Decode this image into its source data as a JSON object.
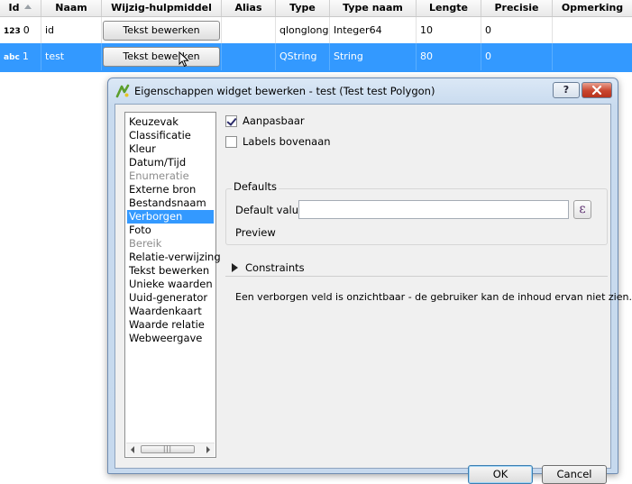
{
  "table": {
    "headers": [
      "Id",
      "Naam",
      "Wijzig-hulpmiddel",
      "Alias",
      "Type",
      "Type naam",
      "Lengte",
      "Precisie",
      "Opmerking"
    ],
    "rows": [
      {
        "type_badge": "123",
        "id": "0",
        "name": "id",
        "widget": "Tekst bewerken",
        "alias": "",
        "type": "qlonglong",
        "type_name": "Integer64",
        "length": "10",
        "precision": "0",
        "comment": ""
      },
      {
        "type_badge": "abc",
        "id": "1",
        "name": "test",
        "widget": "Tekst bewerken",
        "alias": "",
        "type": "QString",
        "type_name": "String",
        "length": "80",
        "precision": "0",
        "comment": ""
      }
    ]
  },
  "dialog": {
    "title": "Eigenschappen widget bewerken - test (Test test Polygon)",
    "help_label": "?",
    "widget_types": [
      {
        "label": "Keuzevak",
        "state": "normal"
      },
      {
        "label": "Classificatie",
        "state": "normal"
      },
      {
        "label": "Kleur",
        "state": "normal"
      },
      {
        "label": "Datum/Tijd",
        "state": "normal"
      },
      {
        "label": "Enumeratie",
        "state": "disabled"
      },
      {
        "label": "Externe bron",
        "state": "normal"
      },
      {
        "label": "Bestandsnaam",
        "state": "normal"
      },
      {
        "label": "Verborgen",
        "state": "selected"
      },
      {
        "label": "Foto",
        "state": "normal"
      },
      {
        "label": "Bereik",
        "state": "disabled"
      },
      {
        "label": "Relatie-verwijzing",
        "state": "normal"
      },
      {
        "label": "Tekst bewerken",
        "state": "normal"
      },
      {
        "label": "Unieke waarden",
        "state": "normal"
      },
      {
        "label": "Uuid-generator",
        "state": "normal"
      },
      {
        "label": "Waardenkaart",
        "state": "normal"
      },
      {
        "label": "Waarde relatie",
        "state": "normal"
      },
      {
        "label": "Webweergave",
        "state": "normal"
      }
    ],
    "editable_label": "Aanpasbaar",
    "editable_checked": true,
    "labels_on_top_label": "Labels bovenaan",
    "labels_on_top_checked": false,
    "defaults_title": "Defaults",
    "default_value_label": "Default value",
    "default_value": "",
    "expression_symbol": "ε",
    "preview_label": "Preview",
    "constraints_label": "Constraints",
    "description": "Een verborgen veld is onzichtbaar - de gebruiker kan de inhoud ervan niet zien.",
    "ok_label": "OK",
    "cancel_label": "Cancel"
  },
  "colors": {
    "selection": "#3399ff",
    "title_bar": "#c9dbef",
    "close_button": "#c9452e"
  }
}
